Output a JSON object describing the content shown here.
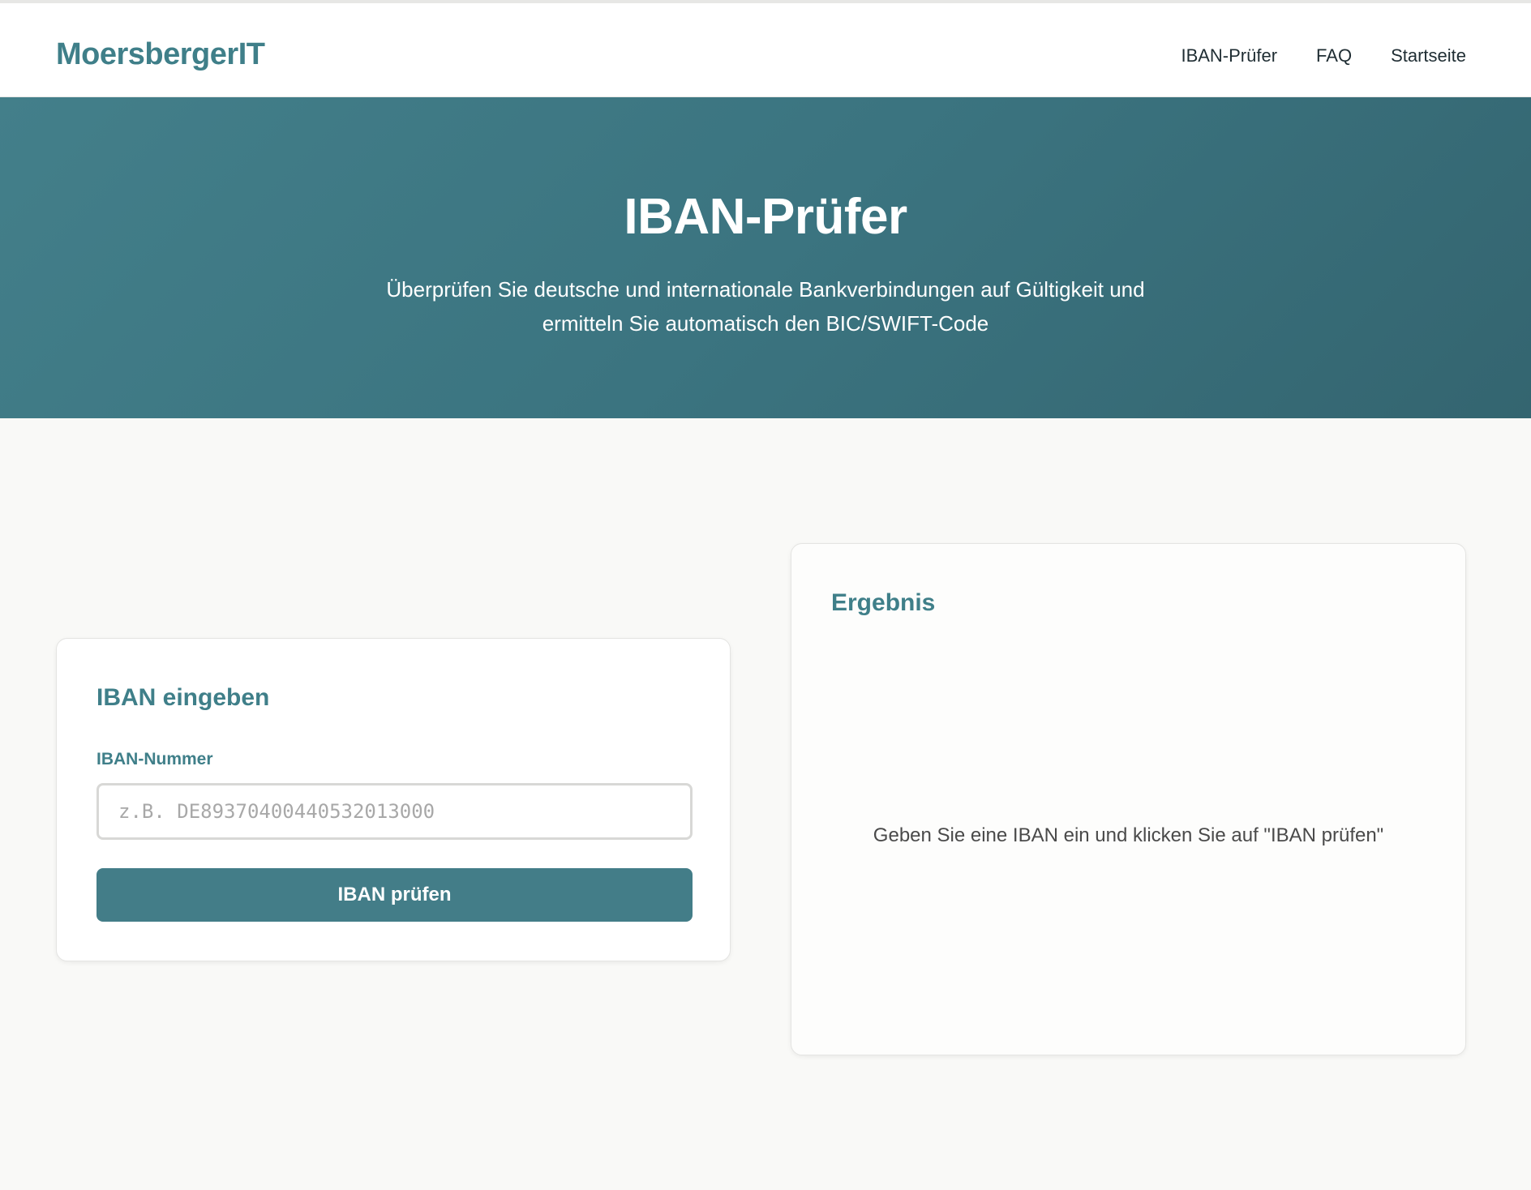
{
  "header": {
    "brand": "MoersbergerIT",
    "nav": [
      {
        "label": "IBAN-Prüfer"
      },
      {
        "label": "FAQ"
      },
      {
        "label": "Startseite"
      }
    ]
  },
  "hero": {
    "title": "IBAN-Prüfer",
    "subtitle": "Überprüfen Sie deutsche und internationale Bankverbindungen auf Gültigkeit und ermitteln Sie automatisch den BIC/SWIFT-Code"
  },
  "input_card": {
    "title": "IBAN eingeben",
    "field_label": "IBAN-Nummer",
    "placeholder": "z.B. DE89370400440532013000",
    "value": "",
    "button_label": "IBAN prüfen"
  },
  "result_card": {
    "title": "Ergebnis",
    "placeholder_text": "Geben Sie eine IBAN ein und klicken Sie auf \"IBAN prüfen\""
  },
  "colors": {
    "accent": "#3f7f89",
    "button": "#437d88",
    "hero_start": "#437f8a",
    "hero_end": "#346570",
    "page_background": "#f9f9f7"
  }
}
